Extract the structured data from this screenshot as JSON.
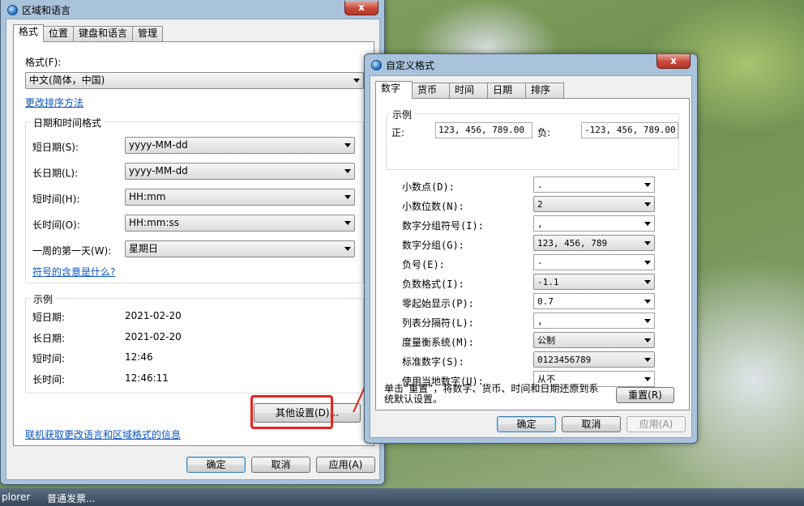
{
  "taskbar": {
    "item1": "plorer",
    "item2": "普通发票..."
  },
  "region_window": {
    "title": "区域和语言",
    "close": "x",
    "tabs": [
      "格式",
      "位置",
      "键盘和语言",
      "管理"
    ],
    "format_label": "格式(F):",
    "format_value": "中文(简体，中国)",
    "change_sort_link": "更改排序方法",
    "datetime_group": "日期和时间格式",
    "rows": [
      {
        "label": "短日期(S):",
        "value": "yyyy-MM-dd"
      },
      {
        "label": "长日期(L):",
        "value": "yyyy-MM-dd"
      },
      {
        "label": "短时间(H):",
        "value": "HH:mm"
      },
      {
        "label": "长时间(O):",
        "value": "HH:mm:ss"
      },
      {
        "label": "一周的第一天(W):",
        "value": "星期日"
      }
    ],
    "symbols_link": "符号的含意是什么?",
    "example_group": "示例",
    "examples": [
      {
        "label": "短日期:",
        "value": "2021-02-20"
      },
      {
        "label": "长日期:",
        "value": "2021-02-20"
      },
      {
        "label": "短时间:",
        "value": "12:46"
      },
      {
        "label": "长时间:",
        "value": "12:46:11"
      }
    ],
    "other_settings": "其他设置(D)...",
    "online_link": "联机获取更改语言和区域格式的信息",
    "ok": "确定",
    "cancel": "取消",
    "apply": "应用(A)"
  },
  "custom_window": {
    "title": "自定义格式",
    "close": "x",
    "tabs": [
      "数字",
      "货币",
      "时间",
      "日期",
      "排序"
    ],
    "example_group": "示例",
    "positive_label": "正:",
    "positive_value": "123, 456, 789.00",
    "negative_label": "负:",
    "negative_value": "-123, 456, 789.00",
    "rows": [
      {
        "label": "小数点(D):",
        "value": "."
      },
      {
        "label": "小数位数(N):",
        "value": "2"
      },
      {
        "label": "数字分组符号(I):",
        "value": ","
      },
      {
        "label": "数字分组(G):",
        "value": "123, 456, 789"
      },
      {
        "label": "负号(E):",
        "value": "-"
      },
      {
        "label": "负数格式(I):",
        "value": "-1.1"
      },
      {
        "label": "零起始显示(P):",
        "value": "0.7"
      },
      {
        "label": "列表分隔符(L):",
        "value": ","
      },
      {
        "label": "度量衡系统(M):",
        "value": "公制"
      },
      {
        "label": "标准数字(S):",
        "value": "0123456789"
      },
      {
        "label": "使用当地数字(U):",
        "value": "从不"
      }
    ],
    "reset_text_line1": "单击“重置”，将数字、货币、时间和日期还原到系",
    "reset_text_line2": "统默认设置。",
    "reset": "重置(R)",
    "ok": "确定",
    "cancel": "取消",
    "apply": "应用(A)"
  },
  "colors": {
    "annotation": "#e5231c",
    "link": "#0b55c4"
  }
}
